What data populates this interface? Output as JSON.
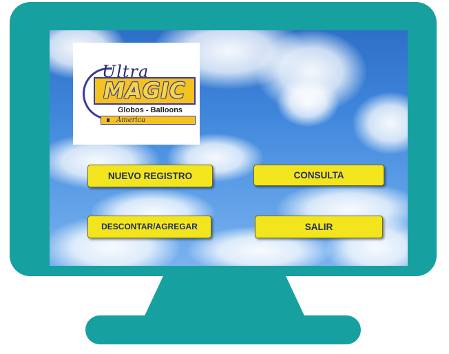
{
  "logo": {
    "brand_top": "Ultra",
    "brand_main": "MAGIC",
    "tagline": "Globos - Balloons",
    "region": "America"
  },
  "buttons": {
    "nuevo_registro": "NUEVO REGISTRO",
    "consulta": "CONSULTA",
    "descontar_agregar": "DESCONTAR/AGREGAR",
    "salir": "SALIR"
  },
  "colors": {
    "monitor": "#17a0a0",
    "button_fill": "#f2e51e",
    "button_text": "#1f2d5c",
    "logo_gold": "#f3c21f"
  },
  "background": "sky-with-clouds"
}
